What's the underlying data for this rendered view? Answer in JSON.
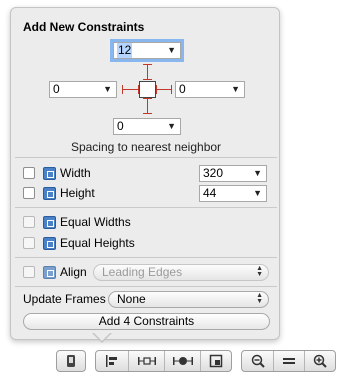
{
  "popover": {
    "title": "Add New Constraints",
    "spacing": {
      "top": "12",
      "left": "0",
      "right": "0",
      "bottom": "0",
      "caption": "Spacing to nearest neighbor"
    },
    "width": {
      "label": "Width",
      "value": "320"
    },
    "height": {
      "label": "Height",
      "value": "44"
    },
    "equal_widths": {
      "label": "Equal Widths"
    },
    "equal_heights": {
      "label": "Equal Heights"
    },
    "align": {
      "label": "Align",
      "value": "Leading Edges"
    },
    "update_frames": {
      "label": "Update Frames",
      "value": "None"
    },
    "add_button": "Add 4 Constraints"
  },
  "toolbar": {
    "groups": [
      [
        "device-icon"
      ],
      [
        "align-icon",
        "pin-icon",
        "resolve-icon",
        "resize-icon"
      ],
      [
        "zoom-out-icon",
        "zoom-actual-icon",
        "zoom-in-icon"
      ]
    ]
  },
  "colors": {
    "accent": "#88b7ef",
    "constraint": "#c0392b",
    "icon_blue": "#4b82c7"
  }
}
